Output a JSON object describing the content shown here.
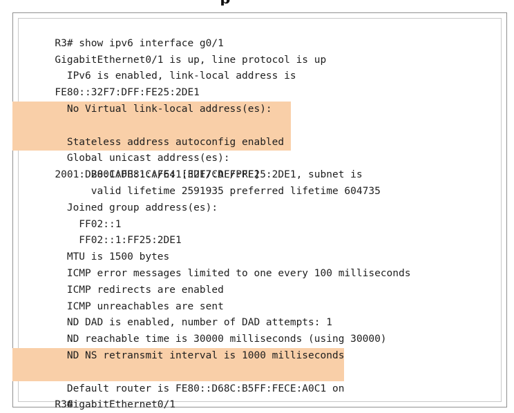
{
  "header": {
    "title_fragment": "p"
  },
  "terminal": {
    "lines": [
      "R3# show ipv6 interface g0/1",
      "GigabitEthernet0/1 is up, line protocol is up",
      "  IPv6 is enabled, link-local address is",
      "FE80::32F7:DFF:FE25:2DE1",
      "  No Virtual link-local address(es):",
      "  Stateless address autoconfig enabled",
      "  Global unicast address(es):",
      "      2001:DB8:CAFE:1:32F7:DFF:FE25:2DE1, subnet is",
      "2001:DB8:CAFE:1::/64 [EUI/CAL/PRE]",
      "      valid lifetime 2591935 preferred lifetime 604735",
      "  Joined group address(es):",
      "    FF02::1",
      "    FF02::1:FF25:2DE1",
      "  MTU is 1500 bytes",
      "  ICMP error messages limited to one every 100 milliseconds",
      "  ICMP redirects are enabled",
      "  ICMP unreachables are sent",
      "  ND DAD is enabled, number of DAD attempts: 1",
      "  ND reachable time is 30000 milliseconds (using 30000)",
      "  ND NS retransmit interval is 1000 milliseconds",
      "  Default router is FE80::D68C:B5FF:FECE:A0C1 on",
      "  GigabitEthernet0/1",
      "R3#"
    ]
  },
  "colors": {
    "highlight": "#f9cfa8",
    "text": "#1e1e1e",
    "border": "#8f8f8f"
  }
}
